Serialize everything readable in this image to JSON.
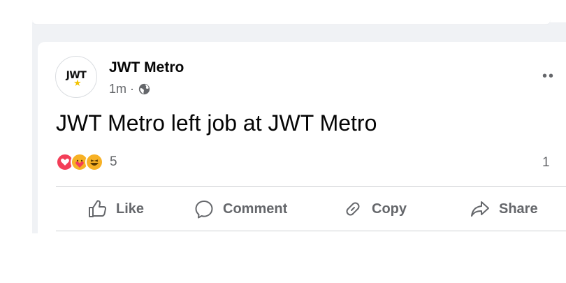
{
  "post": {
    "page_name": "JWT Metro",
    "avatar_text": "JWT",
    "time": "1m",
    "separator": "·",
    "audience_icon": "globe-icon",
    "text": "JWT Metro left job at JWT Metro",
    "more_label": "••",
    "reactions": {
      "icons": [
        "love-reaction-icon",
        "care-reaction-icon",
        "haha-reaction-icon"
      ],
      "count": "5"
    },
    "comments_count": "1"
  },
  "actions": {
    "like": "Like",
    "comment": "Comment",
    "copy": "Copy",
    "share": "Share"
  },
  "colors": {
    "feed_background": "#f0f2f5",
    "secondary_text": "#65676b",
    "love": "#f33e58",
    "haha": "#f7b125"
  }
}
